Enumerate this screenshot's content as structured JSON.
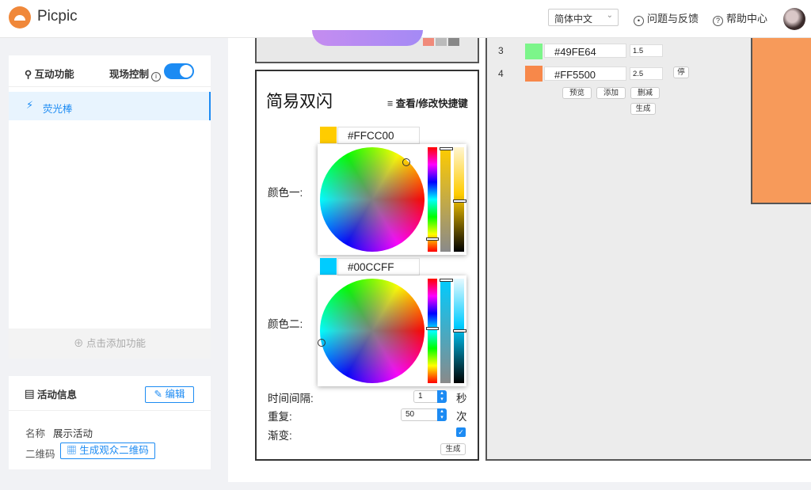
{
  "app": {
    "name": "Picpic"
  },
  "header": {
    "language": "简体中文",
    "feedback": "问题与反馈",
    "help": "帮助中心"
  },
  "sidebar": {
    "features_title": "互动功能",
    "live_control": "现场控制",
    "live_control_on": true,
    "features": [
      {
        "label": "荧光棒"
      }
    ],
    "add_feature": "点击添加功能",
    "activity_title": "活动信息",
    "edit": "编辑",
    "name_label": "名称",
    "name_value": "展示活动",
    "qr_label": "二维码",
    "qr_button": "生成观众二维码"
  },
  "editor": {
    "title": "简易双闪",
    "shortcut_link": "查看/修改快捷键",
    "color1": {
      "label": "颜色一:",
      "hex": "#FFCC00"
    },
    "color2": {
      "label": "颜色二:",
      "hex": "#00CCFF"
    },
    "interval": {
      "label": "时间间隔:",
      "value": "1",
      "unit": "秒"
    },
    "repeat": {
      "label": "重复:",
      "value": "50",
      "unit": "次"
    },
    "gradient": {
      "label": "渐变:",
      "checked": true
    },
    "generate": "生成"
  },
  "sequence": {
    "rows": [
      {
        "index": "3",
        "hex": "#49FE64",
        "color": "#7cf58a",
        "duration": "1.5",
        "action": ""
      },
      {
        "index": "4",
        "hex": "#FF5500",
        "color": "#f7884a",
        "duration": "2.5",
        "action": "停"
      }
    ],
    "buttons": {
      "preview": "预览",
      "add": "添加",
      "delete": "删减",
      "generate": "生成"
    }
  },
  "colors": {
    "accent": "#1c8bf3",
    "preview_orange": "#f79a5a"
  }
}
